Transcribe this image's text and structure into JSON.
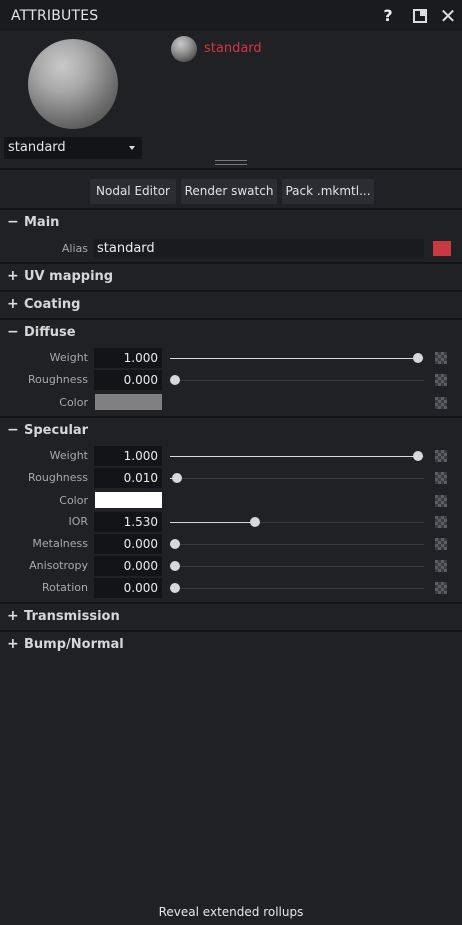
{
  "window": {
    "title": "ATTRIBUTES",
    "help_label": "?",
    "close_label": "✕"
  },
  "preview": {
    "material_name": "standard",
    "material_select": "standard"
  },
  "toolbar": {
    "nodal_editor": "Nodal Editor",
    "render_swatch": "Render swatch",
    "pack": "Pack .mkmtl..."
  },
  "sections": {
    "main": {
      "label": "Main",
      "toggle": "−",
      "alias_label": "Alias",
      "alias_value": "standard",
      "alias_color": "#c93a40"
    },
    "uv_mapping": {
      "label": "UV mapping",
      "toggle": "+"
    },
    "coating": {
      "label": "Coating",
      "toggle": "+"
    },
    "diffuse": {
      "label": "Diffuse",
      "toggle": "−",
      "weight": {
        "label": "Weight",
        "value": "1.000",
        "fraction": 1.0
      },
      "roughness": {
        "label": "Roughness",
        "value": "0.000",
        "fraction": 0.0
      },
      "color": {
        "label": "Color",
        "value": "#808080"
      }
    },
    "specular": {
      "label": "Specular",
      "toggle": "−",
      "weight": {
        "label": "Weight",
        "value": "1.000",
        "fraction": 1.0
      },
      "roughness": {
        "label": "Roughness",
        "value": "0.010",
        "fraction": 0.01
      },
      "color": {
        "label": "Color",
        "value": "#ffffff"
      },
      "ior": {
        "label": "IOR",
        "value": "1.530",
        "fraction": 0.33
      },
      "metalness": {
        "label": "Metalness",
        "value": "0.000",
        "fraction": 0.0
      },
      "anisotropy": {
        "label": "Anisotropy",
        "value": "0.000",
        "fraction": 0.0
      },
      "rotation": {
        "label": "Rotation",
        "value": "0.000",
        "fraction": 0.0
      }
    },
    "transmission": {
      "label": "Transmission",
      "toggle": "+"
    },
    "bump_normal": {
      "label": "Bump/Normal",
      "toggle": "+"
    }
  },
  "footer": {
    "label": "Reveal extended rollups"
  }
}
